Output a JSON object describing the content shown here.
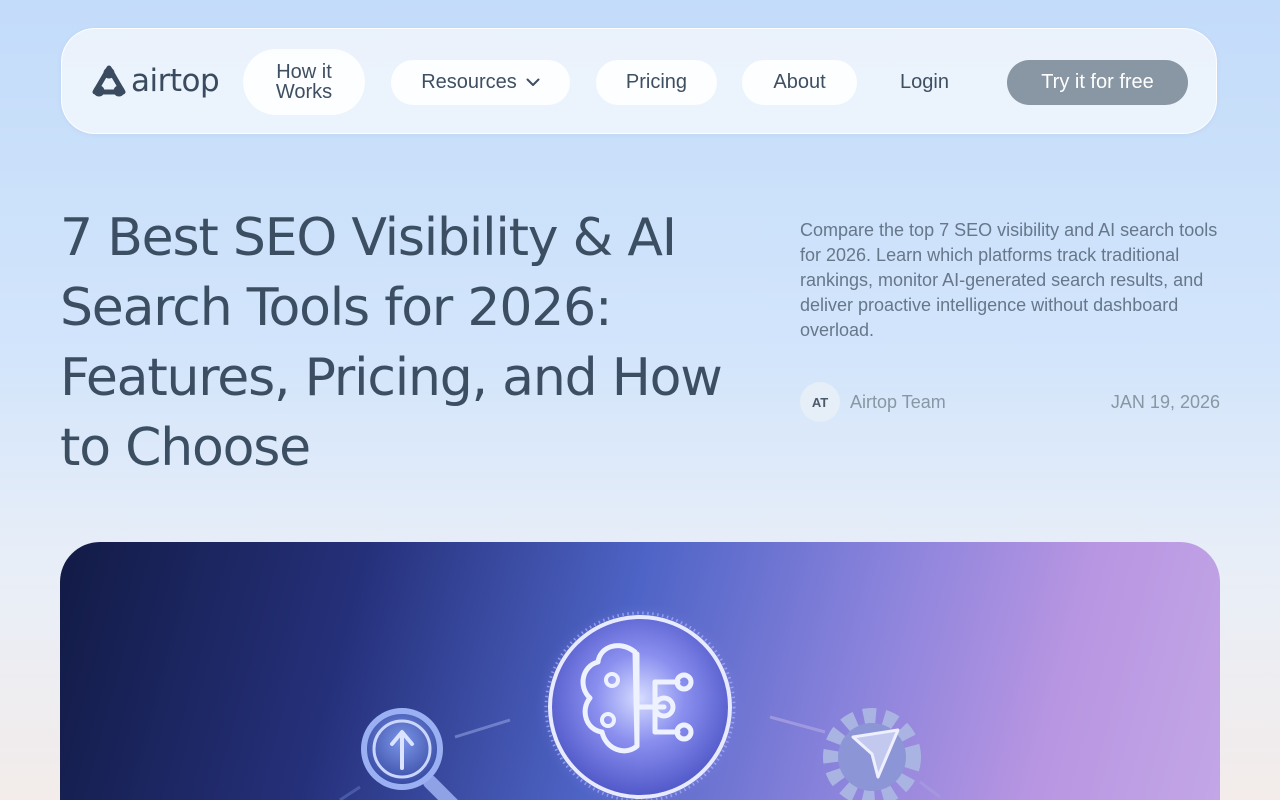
{
  "nav": {
    "logo_text": "airtop",
    "how_it_works_line1": "How it",
    "how_it_works_line2": "Works",
    "resources": "Resources",
    "pricing": "Pricing",
    "about": "About",
    "login": "Login",
    "cta": "Try it for free"
  },
  "article": {
    "title": "7 Best SEO Visibility & AI Search Tools for 2026: Features, Pricing, and How to Choose",
    "description": "Compare the top 7 SEO visibility and AI search tools for 2026. Learn which platforms track traditional rankings, monitor AI-generated search results, and deliver proactive intelligence without dashboard overload.",
    "author_initials": "AT",
    "author_name": "Airtop Team",
    "date": "JAN 19, 2026"
  },
  "hero": {
    "icons": [
      "magnifier-arrow-icon",
      "brain-circuit-icon",
      "gear-cursor-icon"
    ]
  },
  "colors": {
    "cta_bg": "#8996a3",
    "text_primary": "#3c4e62",
    "text_muted": "#8996a3"
  }
}
